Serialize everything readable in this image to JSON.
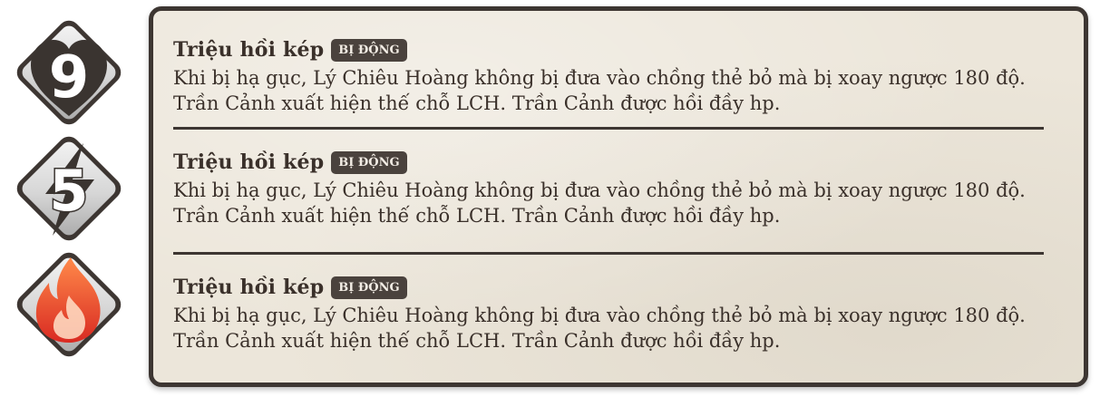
{
  "stats": {
    "hp": {
      "value": "9",
      "icon": "heart-icon",
      "color": "#3a3430"
    },
    "energy": {
      "value": "5",
      "icon": "lightning-icon",
      "color": "#3a3430"
    },
    "element": {
      "icon": "fire-icon",
      "color": "#e8452a"
    }
  },
  "abilities": [
    {
      "name": "Triệu hồi kép",
      "tag": "BỊ ĐỘNG",
      "description": "Khi bị hạ gục, Lý Chiêu Hoàng không bị đưa vào chồng thẻ bỏ mà bị xoay ngược 180 độ. Trần Cảnh xuất hiện thế chỗ LCH. Trần Cảnh được hồi đầy hp."
    },
    {
      "name": "Triệu hồi kép",
      "tag": "BỊ ĐỘNG",
      "description": "Khi bị hạ gục, Lý Chiêu Hoàng không bị đưa vào chồng thẻ bỏ mà bị xoay ngược 180 độ. Trần Cảnh xuất hiện thế chỗ LCH. Trần Cảnh được hồi đầy hp."
    },
    {
      "name": "Triệu hồi kép",
      "tag": "BỊ ĐỘNG",
      "description": "Khi bị hạ gục, Lý Chiêu Hoàng không bị đưa vào chồng thẻ bỏ mà bị xoay ngược 180 độ. Trần Cảnh xuất hiện thế chỗ LCH. Trần Cảnh được hồi đầy hp."
    }
  ]
}
